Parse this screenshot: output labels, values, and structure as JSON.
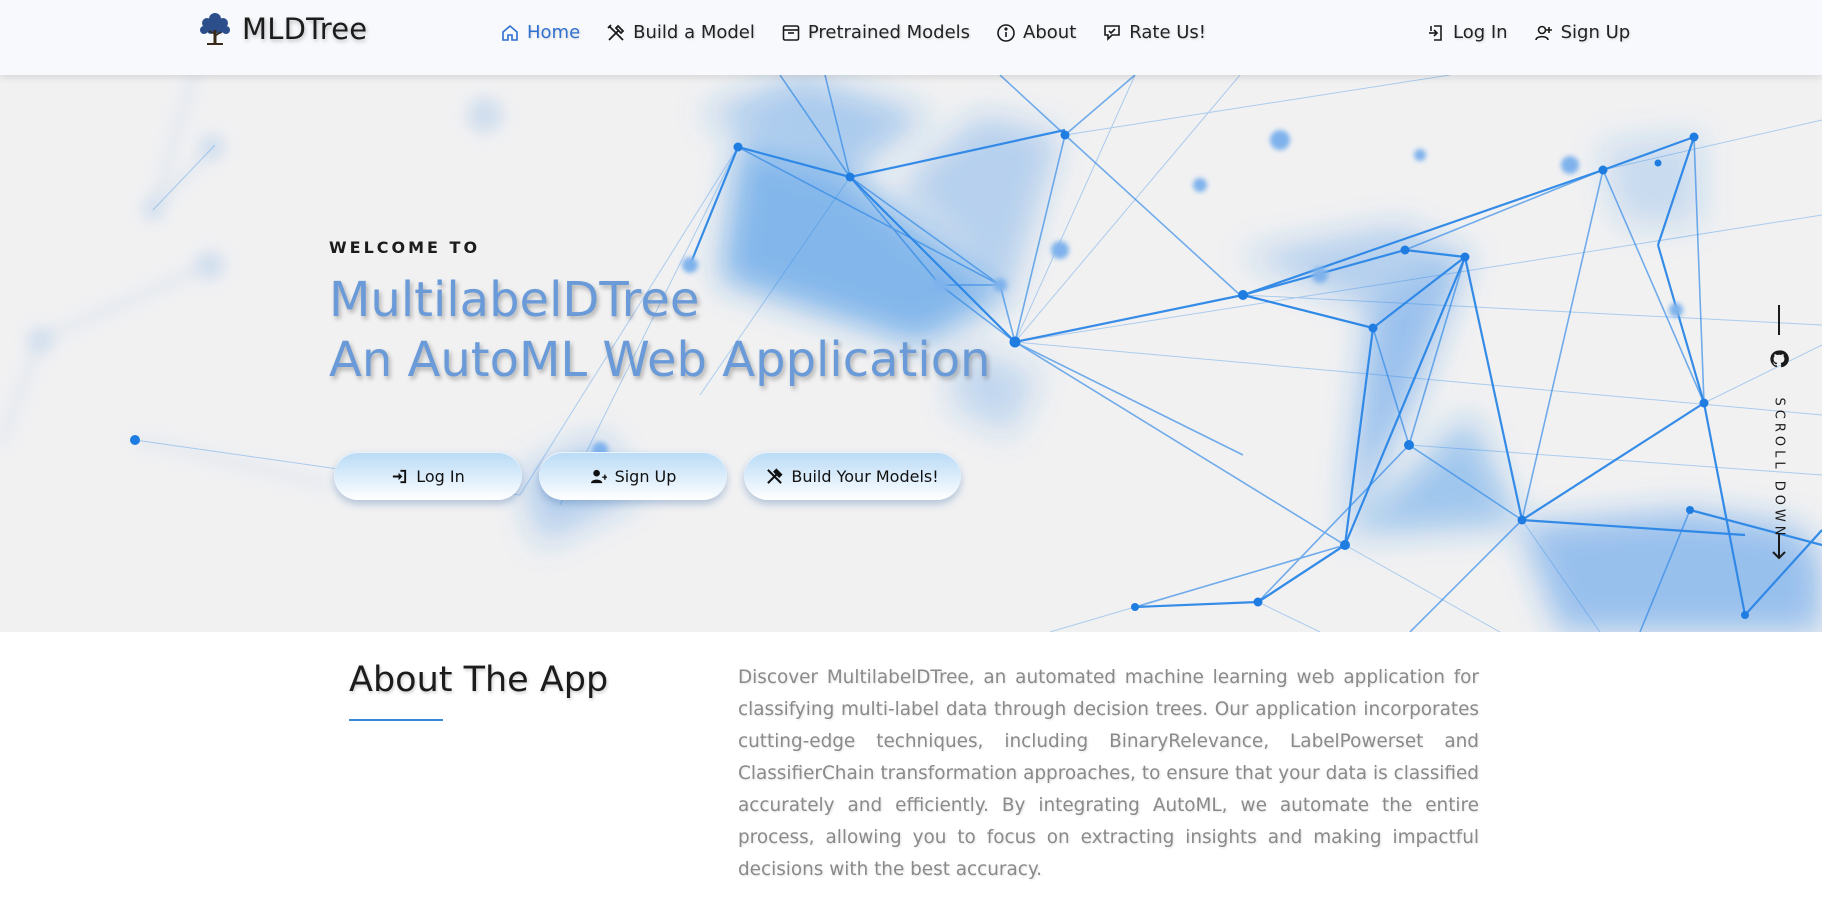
{
  "brand": {
    "name": "MLDTree",
    "logo_icon": "tree-icon"
  },
  "nav": {
    "links": [
      {
        "label": "Home",
        "icon": "home-icon",
        "active": true
      },
      {
        "label": "Build a Model",
        "icon": "tools-icon",
        "active": false
      },
      {
        "label": "Pretrained Models",
        "icon": "archive-icon",
        "active": false
      },
      {
        "label": "About",
        "icon": "info-icon",
        "active": false
      },
      {
        "label": "Rate Us!",
        "icon": "rating-icon",
        "active": false
      }
    ],
    "auth": [
      {
        "label": "Log In",
        "icon": "login-icon"
      },
      {
        "label": "Sign Up",
        "icon": "user-plus-icon"
      }
    ]
  },
  "hero": {
    "welcome": "WELCOME TO",
    "title_line1": "MultilabelDTree",
    "title_line2": "An AutoML Web Application",
    "buttons": {
      "login": "Log In",
      "signup": "Sign Up",
      "build": "Build Your Models!"
    },
    "side": {
      "scroll_label": "SCROLL DOWN",
      "github_icon": "github-icon"
    }
  },
  "about": {
    "heading": "About The App",
    "body": "Discover MultilabelDTree, an automated machine learning web application for classifying multi-label data through decision trees. Our application incorporates cutting-edge techniques, including BinaryRelevance, LabelPowerset and ClassifierChain transformation approaches, to ensure that your data is classified accurately and efficiently. By integrating AutoML, we automate the entire process, allowing you to focus on extracting insights and making impactful decisions with the best accuracy."
  },
  "colors": {
    "accent": "#2f6fd0",
    "hero_title": "#6a9bd8",
    "network": "#2b86e6",
    "about_underline": "#3a87d9"
  }
}
